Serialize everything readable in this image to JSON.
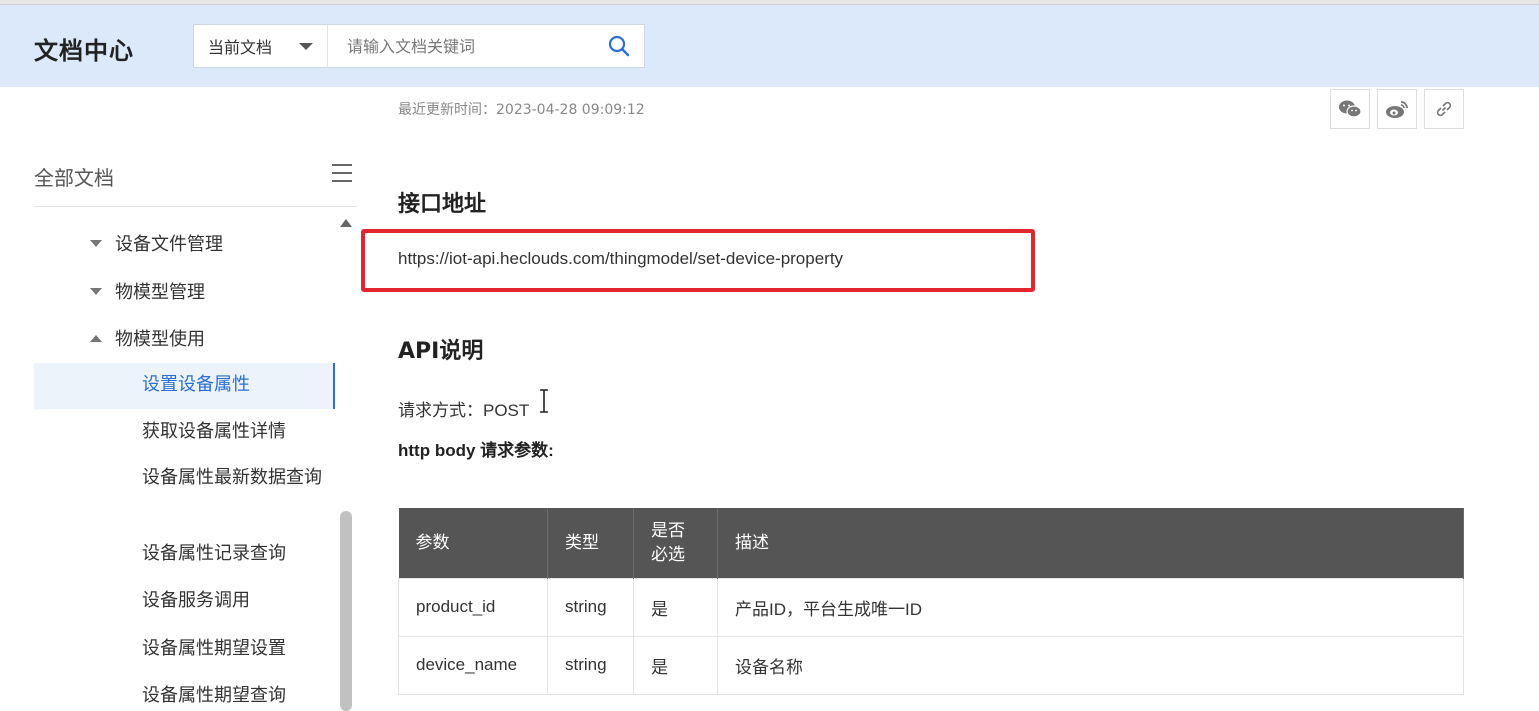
{
  "header": {
    "title": "文档中心",
    "search": {
      "scope": "当前文档",
      "placeholder": "请输入文档关键词"
    }
  },
  "sidebar": {
    "heading": "全部文档",
    "groups": [
      {
        "label": "设备文件管理",
        "expanded": false
      },
      {
        "label": "物模型管理",
        "expanded": false
      },
      {
        "label": "物模型使用",
        "expanded": true
      }
    ],
    "items": [
      {
        "label": "设置设备属性",
        "active": true
      },
      {
        "label": "获取设备属性详情"
      },
      {
        "label": "设备属性最新数据查询"
      },
      {
        "label": "设备属性记录查询"
      },
      {
        "label": "设备服务调用"
      },
      {
        "label": "设备属性期望设置"
      },
      {
        "label": "设备属性期望查询"
      }
    ]
  },
  "main": {
    "updated": "最近更新时间：2023-04-28 09:09:12",
    "share_icons": [
      "wechat-icon",
      "weibo-icon",
      "link-icon"
    ],
    "section_address": "接口地址",
    "api_url": "https://iot-api.heclouds.com/thingmodel/set-device-property",
    "section_api": "API说明",
    "method_label": "请求方式：",
    "method_value": "POST",
    "body_title": "http body 请求参数:",
    "table": {
      "headers": [
        "参数",
        "类型",
        "是否必选",
        "描述"
      ],
      "header_required_line1": "是否",
      "header_required_line2": "必选",
      "rows": [
        {
          "param": "product_id",
          "type": "string",
          "required": "是",
          "desc": "产品ID，平台生成唯一ID"
        },
        {
          "param": "device_name",
          "type": "string",
          "required": "是",
          "desc": "设备名称"
        }
      ]
    }
  },
  "colors": {
    "header_bg": "#dbe9fb",
    "accent": "#2b6fd6",
    "highlight": "#e3262d",
    "table_header": "#555555"
  }
}
